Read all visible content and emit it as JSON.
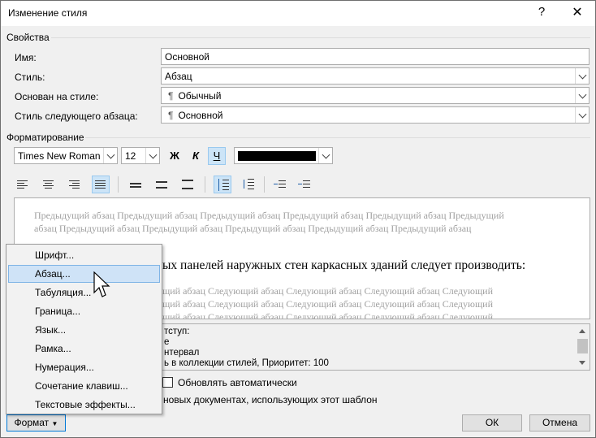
{
  "window": {
    "title": "Изменение стиля",
    "help_glyph": "?",
    "close_glyph": "✕"
  },
  "properties": {
    "heading": "Свойства",
    "name_label": "Имя:",
    "name_value": "Основной",
    "style_label": "Стиль:",
    "style_value": "Абзац",
    "based_on_label": "Основан на стиле:",
    "based_on_value": "Обычный",
    "next_style_label": "Стиль следующего абзаца:",
    "next_style_value": "Основной",
    "pilcrow": "¶"
  },
  "formatting": {
    "heading": "Форматирование",
    "font": "Times New Roman",
    "size": "12",
    "bold": "Ж",
    "italic": "К",
    "underline": "Ч",
    "font_color": "#000000"
  },
  "preview": {
    "previous_text": "Предыдущий абзац Предыдущий абзац Предыдущий абзац Предыдущий абзац Предыдущий абзац Предыдущий абзац Предыдущий абзац Предыдущий абзац Предыдущий абзац Предыдущий абзац Предыдущий абзац",
    "main_text": "ых панелей наружных стен каркасных зданий следует производить:",
    "following_line1": "щий абзац Следующий абзац Следующий абзац Следующий абзац Следующий",
    "following_line2": "щий абзац Следующий абзац Следующий абзац Следующий абзац Следующий",
    "following_line3": "щий абзац Следующий абзац Следующий абзац Следующий абзац Следующий"
  },
  "description": {
    "line1": "тступ:",
    "line2": "е",
    "line3": "нтервал",
    "line4": "ь в коллекции стилей, Приоритет: 100"
  },
  "options": {
    "auto_update": "Обновлять автоматически",
    "template_docs": "новых документах, использующих этот шаблон"
  },
  "menu": {
    "items": [
      "Шрифт...",
      "Абзац...",
      "Табуляция...",
      "Граница...",
      "Язык...",
      "Рамка...",
      "Нумерация...",
      "Сочетание клавиш...",
      "Текстовые эффекты..."
    ]
  },
  "buttons": {
    "format": "Формат",
    "ok": "ОК",
    "cancel": "Отмена"
  },
  "colors": {
    "accent": "#0078d7",
    "highlight": "#cfe3f7",
    "active_toggle": "#cce4f7"
  }
}
